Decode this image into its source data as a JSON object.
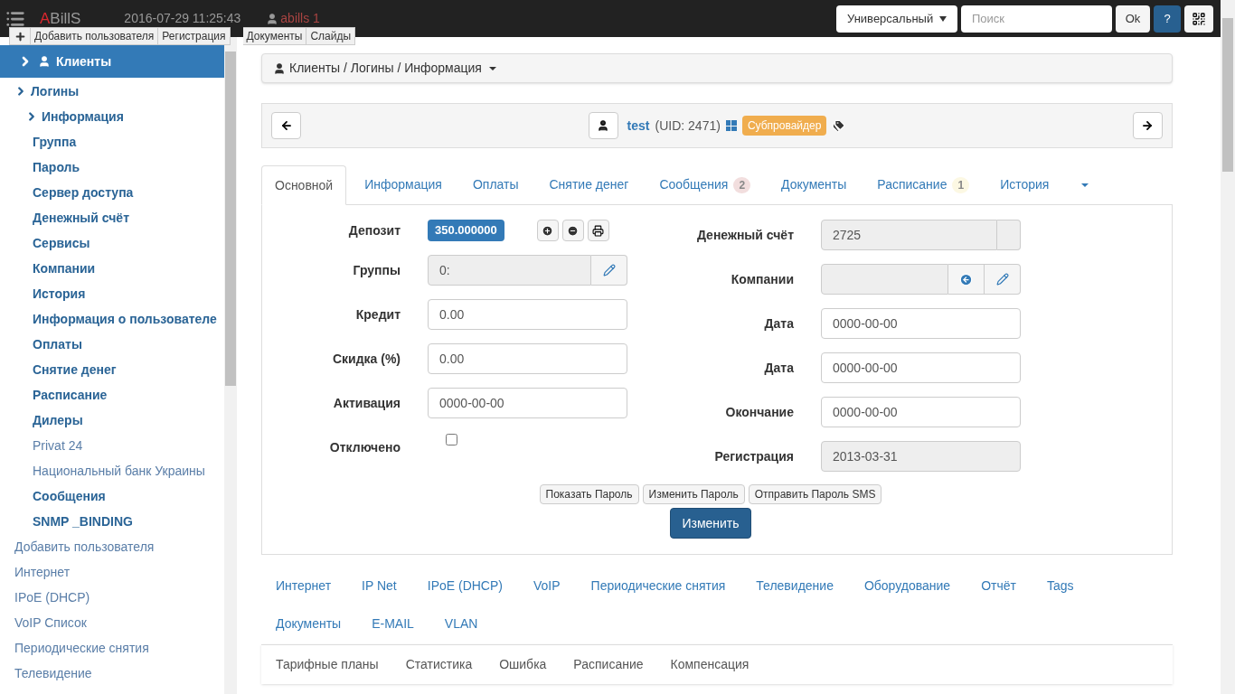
{
  "topbar": {
    "logo": {
      "accent": "A",
      "rest": "BillS"
    },
    "datetime": "2016-07-29 11:25:43",
    "user": "abills 1",
    "search_type": "Универсальный",
    "search": {
      "placeholder": "Поиск"
    },
    "ok": "Ok",
    "help": "?"
  },
  "quick_menu": [
    "Добавить пользователя",
    "Регистрация",
    "Документы",
    "Слайды"
  ],
  "sidebar": {
    "header": "Клиенты",
    "items": [
      {
        "label": "Логины",
        "kind": "section",
        "expanded": true,
        "children": [
          {
            "label": "Информация",
            "kind": "section",
            "expanded": true,
            "children": [
              {
                "label": "Группа",
                "kind": "section"
              },
              {
                "label": "Пароль",
                "kind": "section"
              },
              {
                "label": "Сервер доступа",
                "kind": "section"
              },
              {
                "label": "Денежный счёт",
                "kind": "section"
              },
              {
                "label": "Сервисы",
                "kind": "section"
              },
              {
                "label": "Компании",
                "kind": "section"
              },
              {
                "label": "История",
                "kind": "section"
              },
              {
                "label": "Информация о пользователе",
                "kind": "section"
              },
              {
                "label": "Оплаты",
                "kind": "section"
              },
              {
                "label": "Снятие денег",
                "kind": "section"
              },
              {
                "label": "Расписание",
                "kind": "section"
              },
              {
                "label": "Дилеры",
                "kind": "section"
              },
              {
                "label": "Privat 24",
                "kind": "link"
              },
              {
                "label": "Национальный банк Украины",
                "kind": "link"
              },
              {
                "label": "Сообщения",
                "kind": "section"
              },
              {
                "label": "SNMP _BINDING",
                "kind": "section"
              }
            ]
          }
        ]
      },
      {
        "label": "Добавить пользователя",
        "kind": "link"
      },
      {
        "label": "Интернет",
        "kind": "link"
      },
      {
        "label": "IPoE (DHCP)",
        "kind": "link"
      },
      {
        "label": "VoIP Список",
        "kind": "link"
      },
      {
        "label": "Периодические снятия",
        "kind": "link"
      },
      {
        "label": "Телевидение",
        "kind": "link"
      }
    ]
  },
  "breadcrumb": "Клиенты / Логины / Информация",
  "user_header": {
    "login": "test",
    "uid": "(UID: 2471)",
    "badge": "Субпровайдер"
  },
  "tabs": [
    {
      "label": "Основной",
      "selected": true
    },
    {
      "label": "Информация",
      "selected": false
    },
    {
      "label": "Оплаты",
      "selected": false
    },
    {
      "label": "Снятие денег",
      "selected": false
    },
    {
      "label": "Сообщения",
      "selected": false,
      "badge": "2",
      "color": "#f2dede"
    },
    {
      "label": "Документы",
      "selected": false
    },
    {
      "label": "Расписание",
      "selected": false,
      "badge": "1",
      "color": "#fcf8e3"
    },
    {
      "label": "История",
      "selected": false
    }
  ],
  "form": {
    "left": [
      {
        "label": "Депозит",
        "kind": "deposit",
        "value": "350.000000"
      },
      {
        "label": "Группы",
        "kind": "readonly_edit",
        "value": "0:"
      },
      {
        "label": "Кредит",
        "kind": "input",
        "value": "0.00"
      },
      {
        "label": "Скидка (%)",
        "kind": "input",
        "value": "0.00"
      },
      {
        "label": "Активация",
        "kind": "input",
        "value": "0000-00-00"
      },
      {
        "label": "Отключено",
        "kind": "checkbox",
        "checked": false
      }
    ],
    "right": [
      {
        "label": "Денежный счёт",
        "kind": "readonly_addon",
        "value": "2725"
      },
      {
        "label": "Компании",
        "kind": "readonly_two"
      },
      {
        "label": "Дата",
        "kind": "input",
        "value": "0000-00-00"
      },
      {
        "label": "Дата",
        "kind": "input",
        "value": "0000-00-00"
      },
      {
        "label": "Окончание",
        "kind": "input",
        "value": "0000-00-00"
      },
      {
        "label": "Регистрация",
        "kind": "readonly",
        "value": "2013-03-31"
      }
    ],
    "small_buttons": [
      "Показать Пароль",
      "Изменить Пароль",
      "Отправить Пароль SMS"
    ],
    "submit": "Изменить"
  },
  "service_tabs": [
    [
      "Интернет",
      "IP Net",
      "IPoE (DHCP)",
      "VoIP",
      "Периодические снятия",
      "Телевидение",
      "Оборудование",
      "Отчёт",
      "Tags"
    ],
    [
      "Документы",
      "E-MAIL",
      "VLAN"
    ]
  ],
  "sub_tabs": [
    "Тарифные планы",
    "Статистика",
    "Ошибка",
    "Расписание",
    "Компенсация"
  ]
}
